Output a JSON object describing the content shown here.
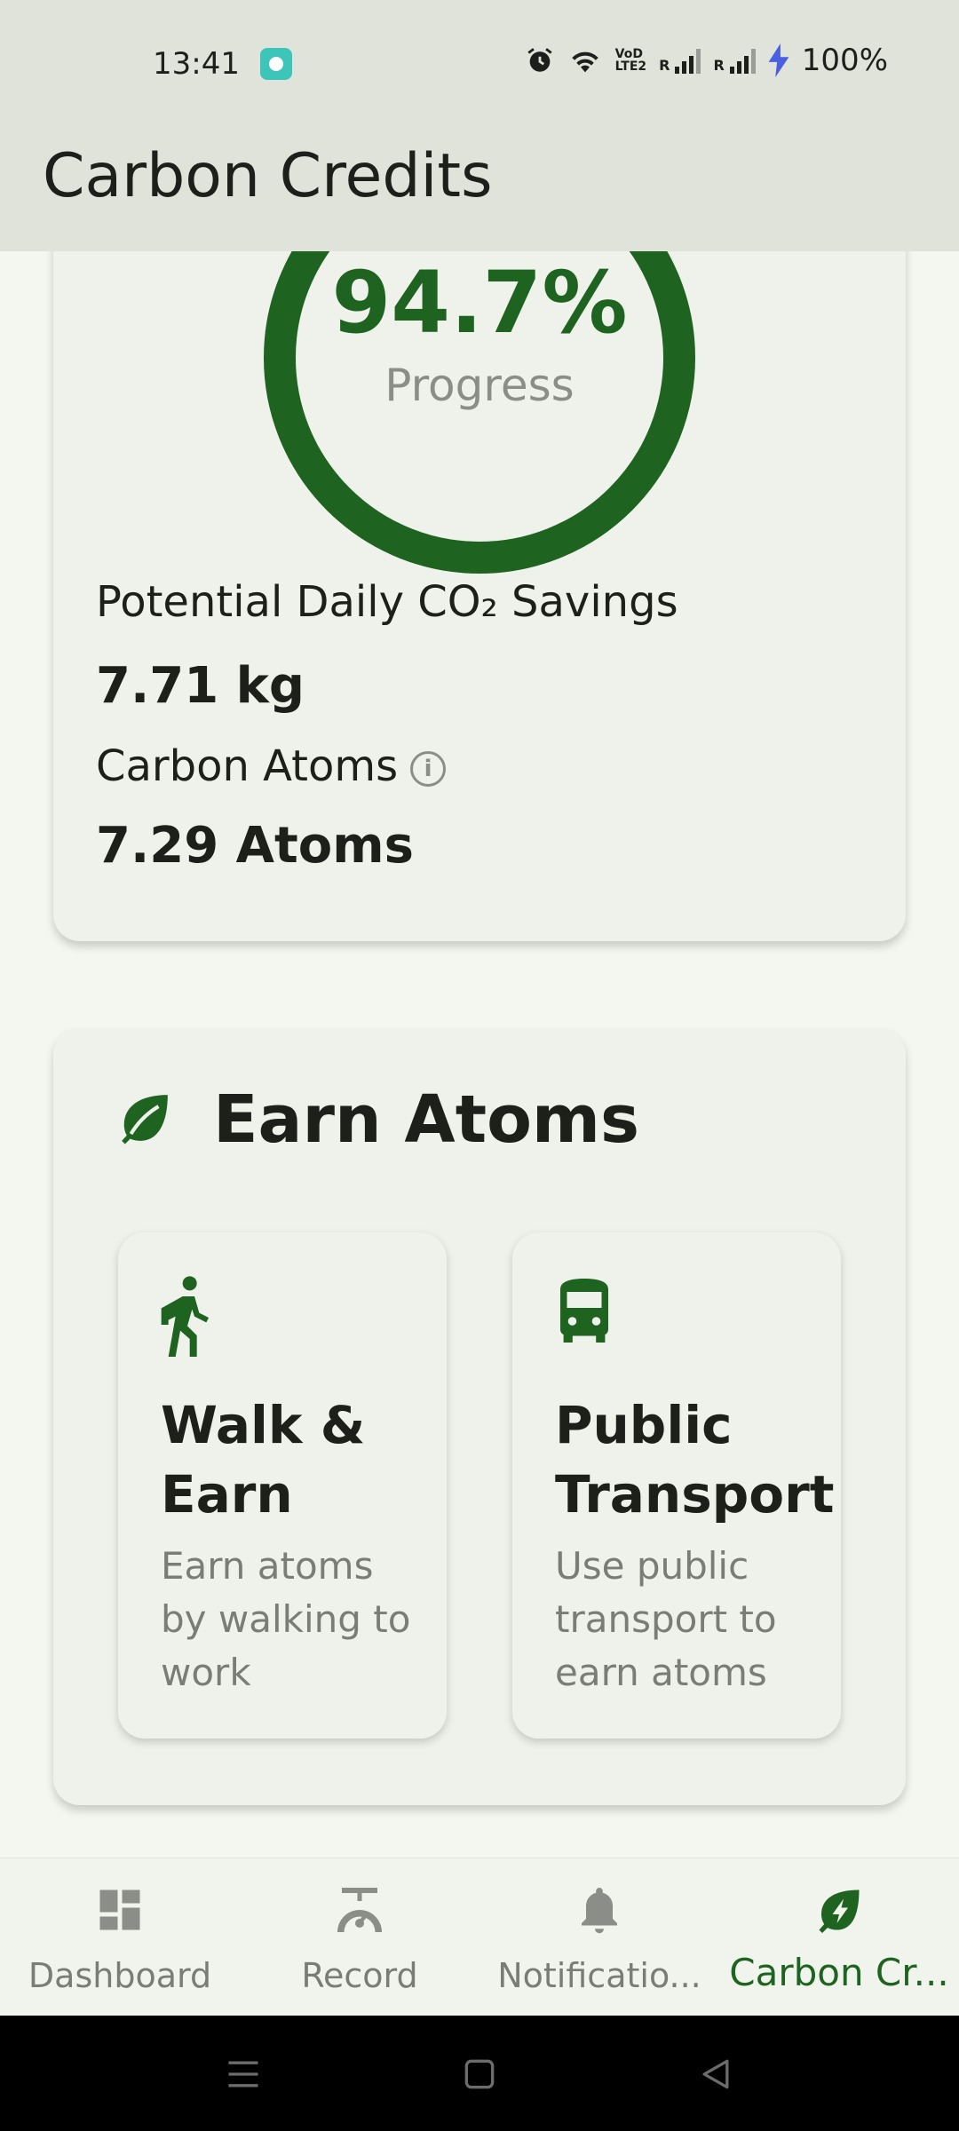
{
  "status_bar": {
    "time": "13:41",
    "battery": "100%",
    "network_label": "VoLTE2",
    "signal_prefix": "R"
  },
  "app_bar": {
    "title": "Carbon Credits"
  },
  "progress_card": {
    "progress_value": "94.7%",
    "progress_fraction": 0.947,
    "progress_label": "Progress",
    "savings_label": "Potential Daily CO₂ Savings",
    "savings_value": "7.71 kg",
    "atoms_label": "Carbon Atoms",
    "atoms_value": "7.29 Atoms",
    "info_icon": "info-icon"
  },
  "earn_card": {
    "title": "Earn Atoms",
    "icon": "leaf-icon",
    "options": [
      {
        "title": "Walk & Earn",
        "description": "Earn atoms by walking to work",
        "icon": "walking-person-icon"
      },
      {
        "title": "Public Transport",
        "description": "Use public transport to earn atoms",
        "icon": "bus-icon"
      }
    ]
  },
  "bottom_nav": {
    "items": [
      {
        "label": "Dashboard",
        "icon": "dashboard-icon",
        "active": false
      },
      {
        "label": "Record",
        "icon": "scale-icon",
        "active": false
      },
      {
        "label": "Notificatio...",
        "icon": "bell-icon",
        "active": false
      },
      {
        "label": "Carbon Cr...",
        "icon": "eco-leaf-bolt-icon",
        "active": true
      }
    ]
  },
  "colors": {
    "accent": "#1e6320",
    "app_bar_bg": "#dfe3da",
    "card_bg": "#eff2eb",
    "page_bg": "#f4f7f0"
  }
}
